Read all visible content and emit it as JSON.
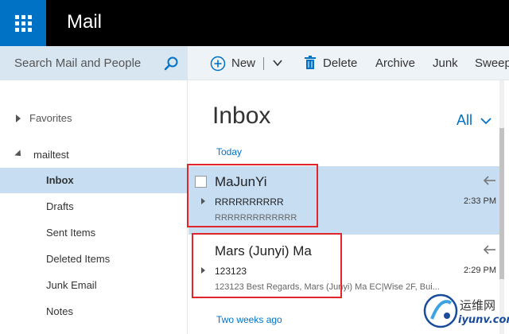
{
  "header": {
    "app_title": "Mail"
  },
  "search": {
    "placeholder": "Search Mail and People"
  },
  "commands": {
    "new_label": "New",
    "delete_label": "Delete",
    "archive_label": "Archive",
    "junk_label": "Junk",
    "sweep_label": "Sweep"
  },
  "folders": {
    "favorites": "Favorites",
    "account": "mailtest",
    "items": [
      {
        "label": "Inbox",
        "selected": true
      },
      {
        "label": "Drafts"
      },
      {
        "label": "Sent Items"
      },
      {
        "label": "Deleted Items"
      },
      {
        "label": "Junk Email"
      },
      {
        "label": "Notes"
      }
    ]
  },
  "list": {
    "title": "Inbox",
    "filter": "All",
    "groups": {
      "today": "Today",
      "two_weeks_ago": "Two weeks ago"
    },
    "messages": [
      {
        "sender": "MaJunYi",
        "subject": "RRRRRRRRRR",
        "preview": "RRRRRRRRRRRRR",
        "time": "2:33 PM",
        "selected": true
      },
      {
        "sender": "Mars (Junyi) Ma",
        "subject": "123123",
        "preview": "123123 Best Regards, Mars (Junyi) Ma EC|Wise 2F, Bui...",
        "time": "2:29 PM"
      }
    ]
  },
  "watermark": {
    "line1": "运维网",
    "line2": "iyunv.com"
  },
  "colors": {
    "accent": "#0072c6",
    "selected": "#c7ddf2",
    "highlight": "#e0262b"
  },
  "icons": [
    "waffle-icon",
    "search-icon",
    "plus-icon",
    "chevron-down-icon",
    "trash-icon",
    "reply-icon"
  ]
}
